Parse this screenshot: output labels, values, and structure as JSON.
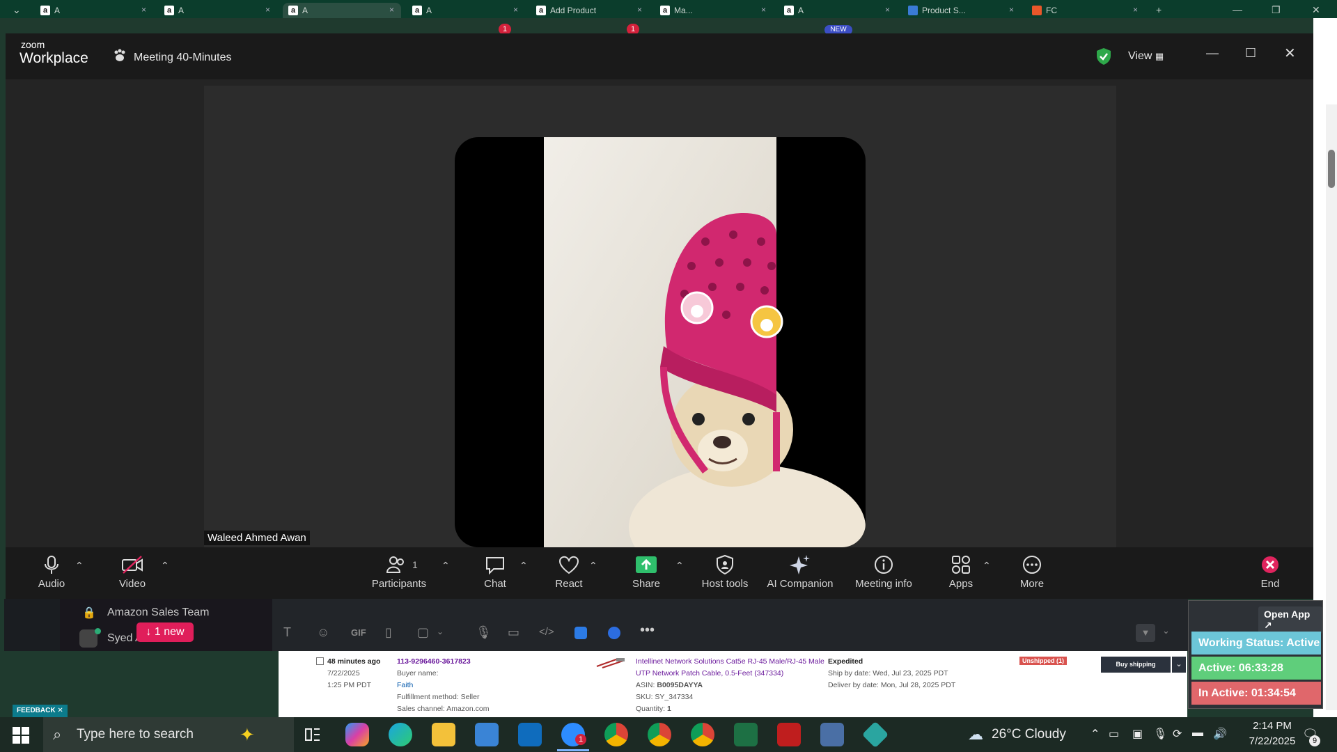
{
  "browser": {
    "tabs": [
      {
        "fav": "a",
        "label": "A"
      },
      {
        "fav": "a",
        "label": "A"
      },
      {
        "fav": "a",
        "label": "A"
      },
      {
        "fav": "a",
        "label": "A"
      },
      {
        "fav": "a",
        "label": "Add Product"
      },
      {
        "fav": "a",
        "label": "Ma..."
      },
      {
        "fav": "a",
        "label": "A"
      },
      {
        "fav": "",
        "label": "Product S..."
      },
      {
        "fav": "",
        "label": "FC"
      }
    ],
    "tab_close": "×",
    "badge_one": "1",
    "badge_new": "NEW"
  },
  "zoom": {
    "brand_top": "zoom",
    "brand_bottom": "Workplace",
    "meeting_title": "Meeting 40-Minutes",
    "view_label": "View",
    "participant_name": "Waleed Ahmed Awan",
    "toolbar": {
      "audio": "Audio",
      "video": "Video",
      "participants": "Participants",
      "participants_count": "1",
      "chat": "Chat",
      "react": "React",
      "share": "Share",
      "host_tools": "Host tools",
      "ai_companion": "AI Companion",
      "meeting_info": "Meeting info",
      "apps": "Apps",
      "more": "More",
      "end": "End"
    }
  },
  "slack": {
    "channel": "Amazon Sales Team",
    "user_partial": "Syed A",
    "new_badge": "1 new",
    "gif": "GIF",
    "open_app": "Open App"
  },
  "order": {
    "time_ago": "48 minutes ago",
    "date": "7/22/2025",
    "time": "1:25 PM PDT",
    "order_id": "113-9296460-3617823",
    "buyer_label": "Buyer name:",
    "buyer": "Faith",
    "fulfillment": "Fulfillment method: Seller",
    "channel": "Sales channel: Amazon.com",
    "product_line1": "Intellinet Network Solutions Cat5e RJ-45 Male/RJ-45 Male",
    "product_line2": "UTP Network Patch Cable, 0.5-Feet (347334)",
    "asin_label": "ASIN:",
    "asin": "B0095DAYYA",
    "sku": "SKU: SY_347334",
    "qty_label": "Quantity:",
    "qty": "1",
    "shipping": "Expedited",
    "ship_by": "Ship by date: Wed, Jul 23, 2025 PDT",
    "deliver_by": "Deliver by date: Mon, Jul 28, 2025 PDT",
    "status": "Unshipped (1)",
    "buy_shipping": "Buy shipping",
    "feedback": "FEEDBACK"
  },
  "status": {
    "working": "Working Status: Active",
    "active": "Active: 06:33:28",
    "inactive": "In Active: 01:34:54",
    "colors": {
      "working": "#6cc6d8",
      "active": "#5fce7b",
      "inactive": "#e0676b"
    }
  },
  "taskbar": {
    "search_placeholder": "Type here to search",
    "weather": "26°C  Cloudy",
    "time": "2:14 PM",
    "date": "7/22/2025",
    "notif_count": "9",
    "zoom_badge": "1"
  }
}
